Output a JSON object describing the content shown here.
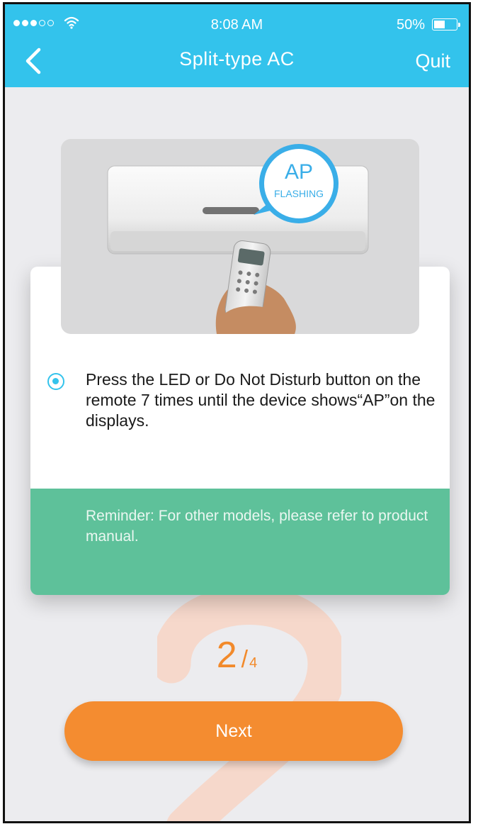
{
  "status_bar": {
    "time": "8:08 AM",
    "battery": "50%",
    "battery_level": 0.5,
    "signal_bars": 3
  },
  "nav": {
    "title": "Split-type AC",
    "quit_label": "Quit"
  },
  "illustration": {
    "badge_main": "AP",
    "badge_sub": "FLASHING"
  },
  "instruction": {
    "text": "Press the LED or Do Not Disturb button on the remote 7 times until the device shows“AP”on the displays."
  },
  "reminder": {
    "text": "Reminder: For other models, please refer to product manual."
  },
  "step": {
    "current": "2",
    "separator": "/",
    "total": "4"
  },
  "next_label": "Next",
  "colors": {
    "header": "#33c3ec",
    "reminder_bg": "#5ec19a",
    "accent_orange": "#f48c30",
    "background": "#ececef"
  }
}
